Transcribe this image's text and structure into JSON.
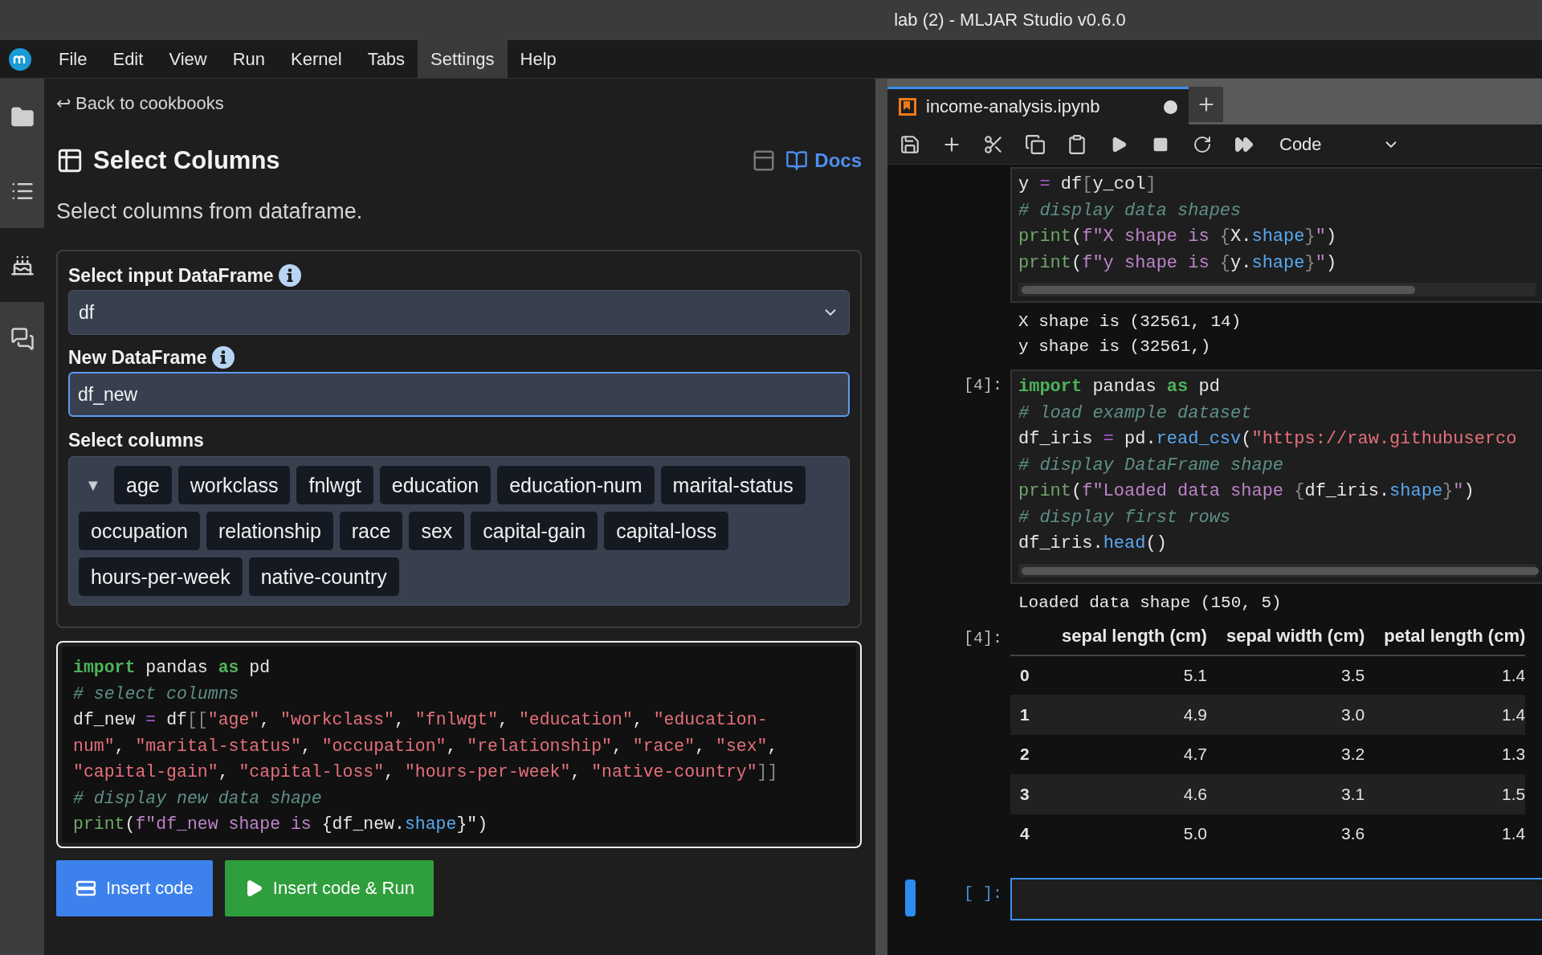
{
  "window": {
    "title": "lab (2) - MLJAR Studio v0.6.0"
  },
  "menu": [
    {
      "label": "File",
      "selected": false
    },
    {
      "label": "Edit",
      "selected": false
    },
    {
      "label": "View",
      "selected": false
    },
    {
      "label": "Run",
      "selected": false
    },
    {
      "label": "Kernel",
      "selected": false
    },
    {
      "label": "Tabs",
      "selected": false
    },
    {
      "label": "Settings",
      "selected": true
    },
    {
      "label": "Help",
      "selected": false
    }
  ],
  "sidebar": {
    "items": [
      {
        "kind": "files",
        "selected": false
      },
      {
        "kind": "toc",
        "selected": false
      },
      {
        "kind": "cookbook",
        "selected": true
      },
      {
        "kind": "chat",
        "selected": false
      }
    ]
  },
  "cookbook": {
    "back_link": "↩ Back to cookbooks",
    "title": "Select Columns",
    "docs_link": "Docs",
    "description": "Select columns from dataframe.",
    "input_dataframe": {
      "label": "Select input DataFrame",
      "value": "df"
    },
    "new_dataframe": {
      "label": "New DataFrame",
      "value": "df_new"
    },
    "columns": {
      "label": "Select columns",
      "toggle": "▼",
      "chips": [
        "age",
        "workclass",
        "fnlwgt",
        "education",
        "education-num",
        "marital-status",
        "occupation",
        "relationship",
        "race",
        "sex",
        "capital-gain",
        "capital-loss",
        "hours-per-week",
        "native-country"
      ]
    },
    "code": [
      [
        {
          "kind": "kw",
          "text": "import"
        },
        {
          "kind": "plain",
          "text": " pandas "
        },
        {
          "kind": "kw",
          "text": "as"
        },
        {
          "kind": "plain",
          "text": " pd"
        }
      ],
      [
        {
          "kind": "comment",
          "text": "# select columns"
        }
      ],
      [
        {
          "kind": "plain",
          "text": "df_new "
        },
        {
          "kind": "op",
          "text": "="
        },
        {
          "kind": "plain",
          "text": " df"
        },
        {
          "kind": "dim",
          "text": "[["
        },
        {
          "kind": "str",
          "text": "\"age\""
        },
        {
          "kind": "plain",
          "text": ", "
        },
        {
          "kind": "str",
          "text": "\"workclass\""
        },
        {
          "kind": "plain",
          "text": ", "
        },
        {
          "kind": "str",
          "text": "\"fnlwgt\""
        },
        {
          "kind": "plain",
          "text": ", "
        },
        {
          "kind": "str",
          "text": "\"education\""
        },
        {
          "kind": "plain",
          "text": ", "
        },
        {
          "kind": "str",
          "text": "\"education-"
        }
      ],
      [
        {
          "kind": "str",
          "text": "num\""
        },
        {
          "kind": "plain",
          "text": ", "
        },
        {
          "kind": "str",
          "text": "\"marital-status\""
        },
        {
          "kind": "plain",
          "text": ", "
        },
        {
          "kind": "str",
          "text": "\"occupation\""
        },
        {
          "kind": "plain",
          "text": ", "
        },
        {
          "kind": "str",
          "text": "\"relationship\""
        },
        {
          "kind": "plain",
          "text": ", "
        },
        {
          "kind": "str",
          "text": "\"race\""
        },
        {
          "kind": "plain",
          "text": ", "
        },
        {
          "kind": "str",
          "text": "\"sex\""
        },
        {
          "kind": "plain",
          "text": ","
        }
      ],
      [
        {
          "kind": "str",
          "text": "\"capital-gain\""
        },
        {
          "kind": "plain",
          "text": ", "
        },
        {
          "kind": "str",
          "text": "\"capital-loss\""
        },
        {
          "kind": "plain",
          "text": ", "
        },
        {
          "kind": "str",
          "text": "\"hours-per-week\""
        },
        {
          "kind": "plain",
          "text": ", "
        },
        {
          "kind": "str",
          "text": "\"native-country\""
        },
        {
          "kind": "dim",
          "text": "]]"
        }
      ],
      [
        {
          "kind": "comment",
          "text": "# display new data shape"
        }
      ],
      [
        {
          "kind": "builtin",
          "text": "print"
        },
        {
          "kind": "plain",
          "text": "("
        },
        {
          "kind": "fstr",
          "text": "f\"df_new shape is "
        },
        {
          "kind": "plain",
          "text": "{df_new."
        },
        {
          "kind": "prop",
          "text": "shape"
        },
        {
          "kind": "plain",
          "text": "}\")"
        }
      ]
    ],
    "buttons": [
      {
        "kind": "insert",
        "label": "Insert code"
      },
      {
        "kind": "run",
        "label": "Insert code & Run"
      }
    ]
  },
  "notebook": {
    "tab": {
      "title": "income-analysis.ipynb",
      "modified": true,
      "selected": true
    },
    "cell_type": "Code",
    "cells": [
      {
        "kind": "code",
        "scroll": true,
        "lines": [
          [
            {
              "kind": "plain",
              "text": "y "
            },
            {
              "kind": "op",
              "text": "="
            },
            {
              "kind": "plain",
              "text": " df"
            },
            {
              "kind": "dim",
              "text": "["
            },
            {
              "kind": "plain",
              "text": "y_col"
            },
            {
              "kind": "dim",
              "text": "]"
            }
          ],
          [
            {
              "kind": "comment",
              "text": "# display data shapes"
            }
          ],
          [
            {
              "kind": "builtin",
              "text": "print"
            },
            {
              "kind": "plain",
              "text": "("
            },
            {
              "kind": "fstr",
              "text": "f\"X shape is "
            },
            {
              "kind": "dim",
              "text": "{"
            },
            {
              "kind": "plain",
              "text": "X."
            },
            {
              "kind": "prop",
              "text": "shape"
            },
            {
              "kind": "dim",
              "text": "}"
            },
            {
              "kind": "fstr",
              "text": "\""
            },
            {
              "kind": "plain",
              "text": ")"
            }
          ],
          [
            {
              "kind": "builtin",
              "text": "print"
            },
            {
              "kind": "plain",
              "text": "("
            },
            {
              "kind": "fstr",
              "text": "f\"y shape is "
            },
            {
              "kind": "dim",
              "text": "{"
            },
            {
              "kind": "plain",
              "text": "y."
            },
            {
              "kind": "prop",
              "text": "shape"
            },
            {
              "kind": "dim",
              "text": "}"
            },
            {
              "kind": "fstr",
              "text": "\""
            },
            {
              "kind": "plain",
              "text": ")"
            }
          ]
        ]
      },
      {
        "kind": "stream",
        "lines": [
          "X shape is (32561, 14)",
          "y shape is (32561,)"
        ]
      },
      {
        "kind": "code",
        "prompt": "[4]:",
        "scroll": true,
        "lines": [
          [
            {
              "kind": "kw",
              "text": "import"
            },
            {
              "kind": "plain",
              "text": " pandas "
            },
            {
              "kind": "kw",
              "text": "as"
            },
            {
              "kind": "plain",
              "text": " pd"
            }
          ],
          [
            {
              "kind": "comment",
              "text": "# load example dataset"
            }
          ],
          [
            {
              "kind": "plain",
              "text": "df_iris "
            },
            {
              "kind": "op",
              "text": "="
            },
            {
              "kind": "plain",
              "text": " pd."
            },
            {
              "kind": "prop",
              "text": "read_csv"
            },
            {
              "kind": "plain",
              "text": "("
            },
            {
              "kind": "str",
              "text": "\"https://raw.githubuserco"
            }
          ],
          [
            {
              "kind": "comment",
              "text": "# display DataFrame shape"
            }
          ],
          [
            {
              "kind": "builtin",
              "text": "print"
            },
            {
              "kind": "plain",
              "text": "("
            },
            {
              "kind": "fstr",
              "text": "f\"Loaded data shape "
            },
            {
              "kind": "dim",
              "text": "{"
            },
            {
              "kind": "plain",
              "text": "df_iris."
            },
            {
              "kind": "prop",
              "text": "shape"
            },
            {
              "kind": "dim",
              "text": "}"
            },
            {
              "kind": "fstr",
              "text": "\""
            },
            {
              "kind": "plain",
              "text": ")"
            }
          ],
          [
            {
              "kind": "comment",
              "text": "# display first rows"
            }
          ],
          [
            {
              "kind": "plain",
              "text": "df_iris."
            },
            {
              "kind": "prop",
              "text": "head"
            },
            {
              "kind": "plain",
              "text": "()"
            }
          ]
        ]
      },
      {
        "kind": "stream",
        "lines": [
          "Loaded data shape (150, 5)"
        ]
      },
      {
        "kind": "table",
        "prompt": "[4]:",
        "columns": [
          "",
          "sepal length (cm)",
          "sepal width (cm)",
          "petal length (cm)"
        ],
        "rows": [
          [
            "0",
            "5.1",
            "3.5",
            "1.4"
          ],
          [
            "1",
            "4.9",
            "3.0",
            "1.4"
          ],
          [
            "2",
            "4.7",
            "3.2",
            "1.3"
          ],
          [
            "3",
            "4.6",
            "3.1",
            "1.5"
          ],
          [
            "4",
            "5.0",
            "3.6",
            "1.4"
          ]
        ]
      },
      {
        "kind": "code",
        "prompt": "[ ]:",
        "active": true
      }
    ]
  }
}
